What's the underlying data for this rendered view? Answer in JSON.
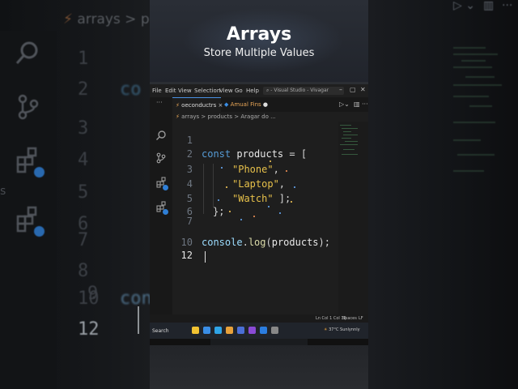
{
  "header": {
    "title": "Arrays",
    "subtitle": "Store Multiple Values"
  },
  "background": {
    "breadcrumb": "arrays > produ",
    "line_numbers": [
      "1",
      "2",
      "3",
      "4",
      "5",
      "6",
      "7",
      "8",
      "9",
      "10",
      "12"
    ],
    "left_fragment_top": "co",
    "left_fragment_bottom": "conso",
    "side_letter": "s"
  },
  "window": {
    "menu": [
      "File",
      "Edit",
      "View",
      "Selection",
      "View",
      "Go",
      "Help"
    ],
    "search_text": "- Visual Studio - Vivagar",
    "tabs": [
      {
        "label": "oeconductrs",
        "close": "×"
      },
      {
        "label": "Amual Fins",
        "close": "●"
      }
    ],
    "breadcrumb": "arrays > products > Aragar do ..."
  },
  "editor": {
    "line_numbers": [
      "1",
      "2",
      "3",
      "4",
      "5",
      "6",
      "7",
      "10",
      "12"
    ],
    "current_line": "12",
    "lines": {
      "l2_kw": "const",
      "l2_var": "products",
      "l2_rest": " = [",
      "l3": "\"Phone\"",
      "l3_p": ",",
      "l4": "\"Laptop\"",
      "l4_p": ",",
      "l5": "\"Watch\"",
      "l5_p": " ];",
      "l6": "};",
      "l10_obj": "console",
      "l10_dot": ".",
      "l10_fn": "log",
      "l10_open": "(",
      "l10_arg": "products",
      "l10_close": ");"
    }
  },
  "statusbar": {
    "position": "Ln Col 1 Col 16",
    "spaces": "Spaces",
    "eol": "LF"
  },
  "taskbar": {
    "search": "Search",
    "weather": "37°C Sunlynnly"
  },
  "colors": {
    "keyword": "#569cd6",
    "variable": "#9cdcfe",
    "string": "#ce9178",
    "function": "#dcdcaa",
    "accent": "#2f7fd6"
  }
}
